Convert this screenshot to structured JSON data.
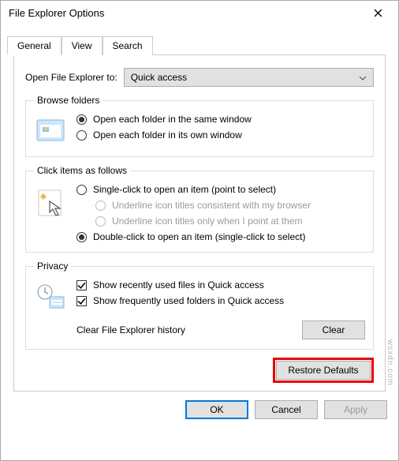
{
  "window": {
    "title": "File Explorer Options"
  },
  "tabs": {
    "general": "General",
    "view": "View",
    "search": "Search"
  },
  "open_to": {
    "label": "Open File Explorer to:",
    "value": "Quick access"
  },
  "browse": {
    "legend": "Browse folders",
    "same": "Open each folder in the same window",
    "own": "Open each folder in its own window"
  },
  "click": {
    "legend": "Click items as follows",
    "single": "Single-click to open an item (point to select)",
    "u1": "Underline icon titles consistent with my browser",
    "u2": "Underline icon titles only when I point at them",
    "double": "Double-click to open an item (single-click to select)"
  },
  "privacy": {
    "legend": "Privacy",
    "recent": "Show recently used files in Quick access",
    "freq": "Show frequently used folders in Quick access",
    "clear_label": "Clear File Explorer history",
    "clear_btn": "Clear"
  },
  "restore": "Restore Defaults",
  "footer": {
    "ok": "OK",
    "cancel": "Cancel",
    "apply": "Apply"
  },
  "watermark": "wsxdn.com"
}
